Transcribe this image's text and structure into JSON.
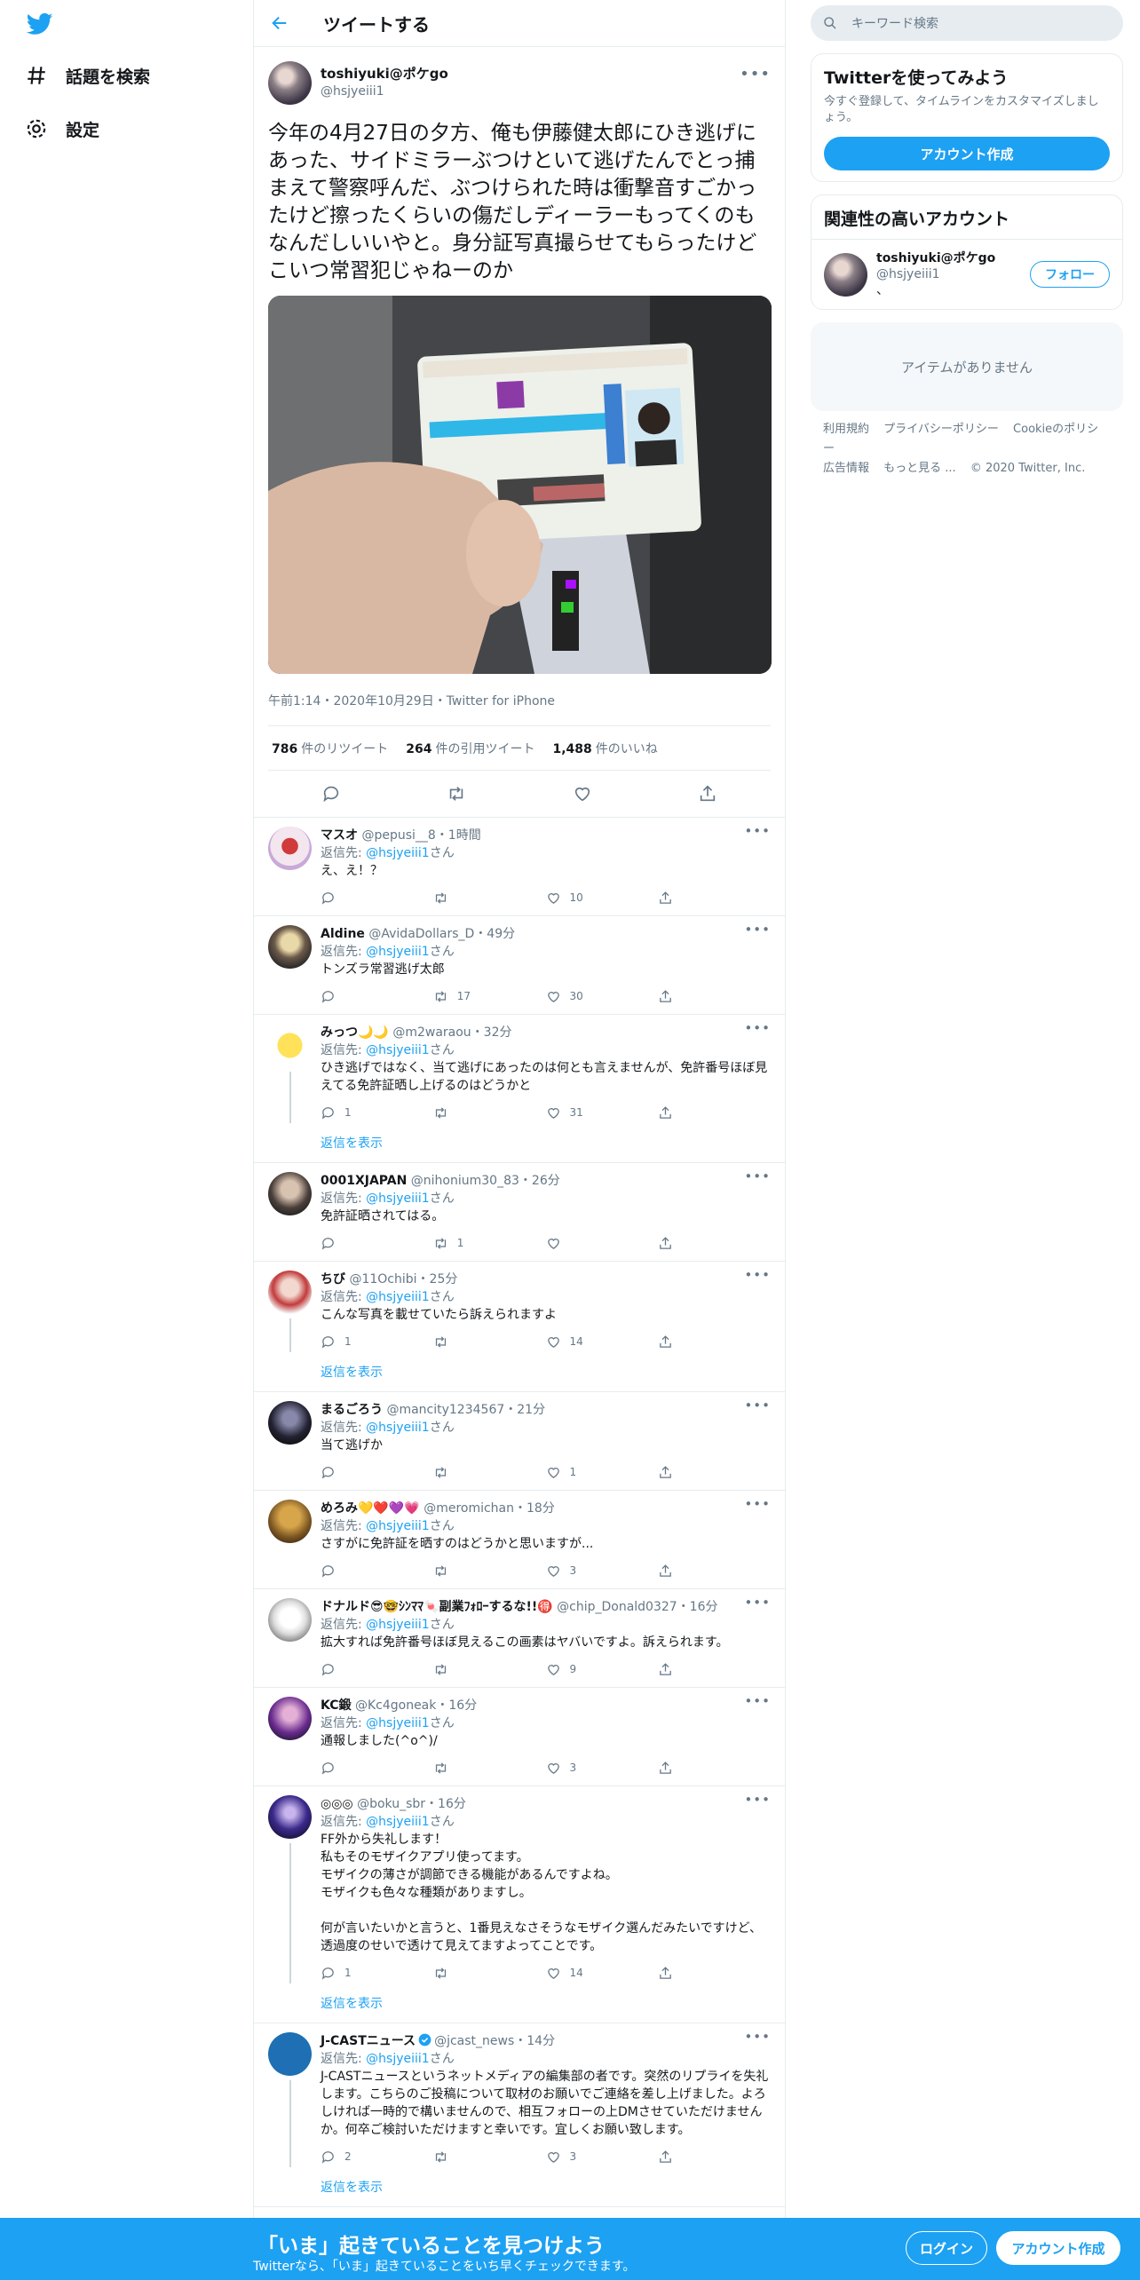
{
  "nav": {
    "explore_label": "話題を検索",
    "settings_label": "設定"
  },
  "header": {
    "title": "ツイートする"
  },
  "main_tweet": {
    "name": "toshiyuki@ポケgo",
    "handle": "@hsjyeiii1",
    "text": "今年の4月27日の夕方、俺も伊藤健太郎にひき逃げにあった、サイドミラーぶつけといて逃げたんでとっ捕まえて警察呼んだ、ぶつけられた時は衝撃音すごかったけど擦ったくらいの傷だしディーラーもってくのもなんだしいいやと。身分証写真撮らせてもらったけどこいつ常習犯じゃねーのか",
    "meta": "午前1:14・2020年10月29日・Twitter for iPhone",
    "retweets": "786",
    "retweets_label": "件のリツイート",
    "quotes": "264",
    "quotes_label": "件の引用ツイート",
    "likes": "1,488",
    "likes_label": "件のいいね"
  },
  "replies": [
    {
      "name": "マスオ",
      "handle": "@pepusi__8",
      "time": "・1時間",
      "to_prefix": "返信先: ",
      "to_handle": "@hsjyeiii1",
      "to_suffix": "さん",
      "text": "え、え！？",
      "reply": "",
      "retweet": "",
      "like": "10",
      "showmore": ""
    },
    {
      "name": "Aldine",
      "handle": "@AvidaDollars_D",
      "time": "・49分",
      "to_prefix": "返信先: ",
      "to_handle": "@hsjyeiii1",
      "to_suffix": "さん",
      "text": "トンズラ常習逃げ太郎",
      "reply": "",
      "retweet": "17",
      "like": "30",
      "showmore": ""
    },
    {
      "name": "みっつ🌙🌙",
      "handle": "@m2waraou",
      "time": "・32分",
      "to_prefix": "返信先: ",
      "to_handle": "@hsjyeiii1",
      "to_suffix": "さん",
      "text": "ひき逃げではなく、当て逃げにあったのは何とも言えませんが、免許番号ほぼ見えてる免許証晒し上げるのはどうかと",
      "reply": "1",
      "retweet": "",
      "like": "31",
      "showmore": "返信を表示"
    },
    {
      "name": "0001XJAPAN",
      "handle": "@nihonium30_83",
      "time": "・26分",
      "to_prefix": "返信先: ",
      "to_handle": "@hsjyeiii1",
      "to_suffix": "さん",
      "text": "免許証晒されてはる。",
      "reply": "",
      "retweet": "1",
      "like": "",
      "showmore": ""
    },
    {
      "name": "ちび",
      "handle": "@11Ochibi",
      "time": "・25分",
      "to_prefix": "返信先: ",
      "to_handle": "@hsjyeiii1",
      "to_suffix": "さん",
      "text": "こんな写真を載せていたら訴えられますよ",
      "reply": "1",
      "retweet": "",
      "like": "14",
      "showmore": "返信を表示"
    },
    {
      "name": "まるごろう",
      "handle": "@mancity1234567",
      "time": "・21分",
      "to_prefix": "返信先: ",
      "to_handle": "@hsjyeiii1",
      "to_suffix": "さん",
      "text": "当て逃げか",
      "reply": "",
      "retweet": "",
      "like": "1",
      "showmore": ""
    },
    {
      "name": "めろみ💛❤️💜💗",
      "handle": "@meromichan",
      "time": "・18分",
      "to_prefix": "返信先: ",
      "to_handle": "@hsjyeiii1",
      "to_suffix": "さん",
      "text": "さすがに免許証を晒すのはどうかと思いますが...",
      "reply": "",
      "retweet": "",
      "like": "3",
      "showmore": ""
    },
    {
      "name": "ドナルド😎🤓ｼﾝﾏﾏ🍬副業ﾌｫﾛｰするな!!🉐",
      "handle": "@chip_Donald0327",
      "time": "・16分",
      "to_prefix": "返信先: ",
      "to_handle": "@hsjyeiii1",
      "to_suffix": "さん",
      "text": "拡大すれば免許番号ほぼ見えるこの画素はヤバいですよ。訴えられます。",
      "reply": "",
      "retweet": "",
      "like": "9",
      "showmore": ""
    },
    {
      "name": "KC鍛",
      "handle": "@Kc4goneak",
      "time": "・16分",
      "to_prefix": "返信先: ",
      "to_handle": "@hsjyeiii1",
      "to_suffix": "さん",
      "text": "通報しました(^o^)/",
      "reply": "",
      "retweet": "",
      "like": "3",
      "showmore": ""
    },
    {
      "name": "◎◎◎",
      "handle": "@boku_sbr",
      "time": "・16分",
      "to_prefix": "返信先: ",
      "to_handle": "@hsjyeiii1",
      "to_suffix": "さん",
      "text": "FF外から失礼します！\n私もそのモザイクアプリ使ってます。\nモザイクの薄さが調節できる機能があるんですよね。\nモザイクも色々な種類がありますし。\n\n何が言いたいかと言うと、1番見えなさそうなモザイク選んだみたいですけど、透過度のせいで透けて見えてますよってことです。",
      "reply": "1",
      "retweet": "",
      "like": "14",
      "showmore": "返信を表示"
    },
    {
      "name": "J-CASTニュース",
      "handle": "@jcast_news",
      "time": "・14分",
      "to_prefix": "返信先: ",
      "to_handle": "@hsjyeiii1",
      "to_suffix": "さん",
      "text": "J-CASTニュースというネットメディアの編集部の者です。突然のリプライを失礼します。こちらのご投稿について取材のお願いでご連絡を差し上げました。よろしければ一時的で構いませんので、相互フォローの上DMさせていただけませんか。何卒ご検討いただけますと幸いです。宜しくお願い致します。",
      "reply": "2",
      "retweet": "",
      "like": "3",
      "showmore": "返信を表示"
    }
  ],
  "right": {
    "search_placeholder": "キーワード検索",
    "try_title": "Twitterを使ってみよう",
    "try_text": "今すぐ登録して、タイムラインをカスタマイズしましょう。",
    "create_account": "アカウント作成",
    "related_title": "関連性の高いアカウント",
    "related_name": "toshiyuki@ポケgo",
    "related_handle": "@hsjyeiii1",
    "related_bio": "、",
    "follow": "フォロー",
    "no_items": "アイテムがありません",
    "footer": [
      "利用規約",
      "プライバシーポリシー",
      "Cookieのポリシー",
      "広告情報",
      "もっと見る ...",
      "© 2020 Twitter, Inc."
    ]
  },
  "banner": {
    "title": "「いま」起きていることを見つけよう",
    "subtitle": "Twitterなら、「いま」起きていることをいち早くチェックできます。",
    "login": "ログイン",
    "signup": "アカウント作成"
  },
  "colors": {
    "accent": "#1da1f2",
    "text": "#14171a",
    "muted": "#657786",
    "border": "#e6ecf0"
  }
}
